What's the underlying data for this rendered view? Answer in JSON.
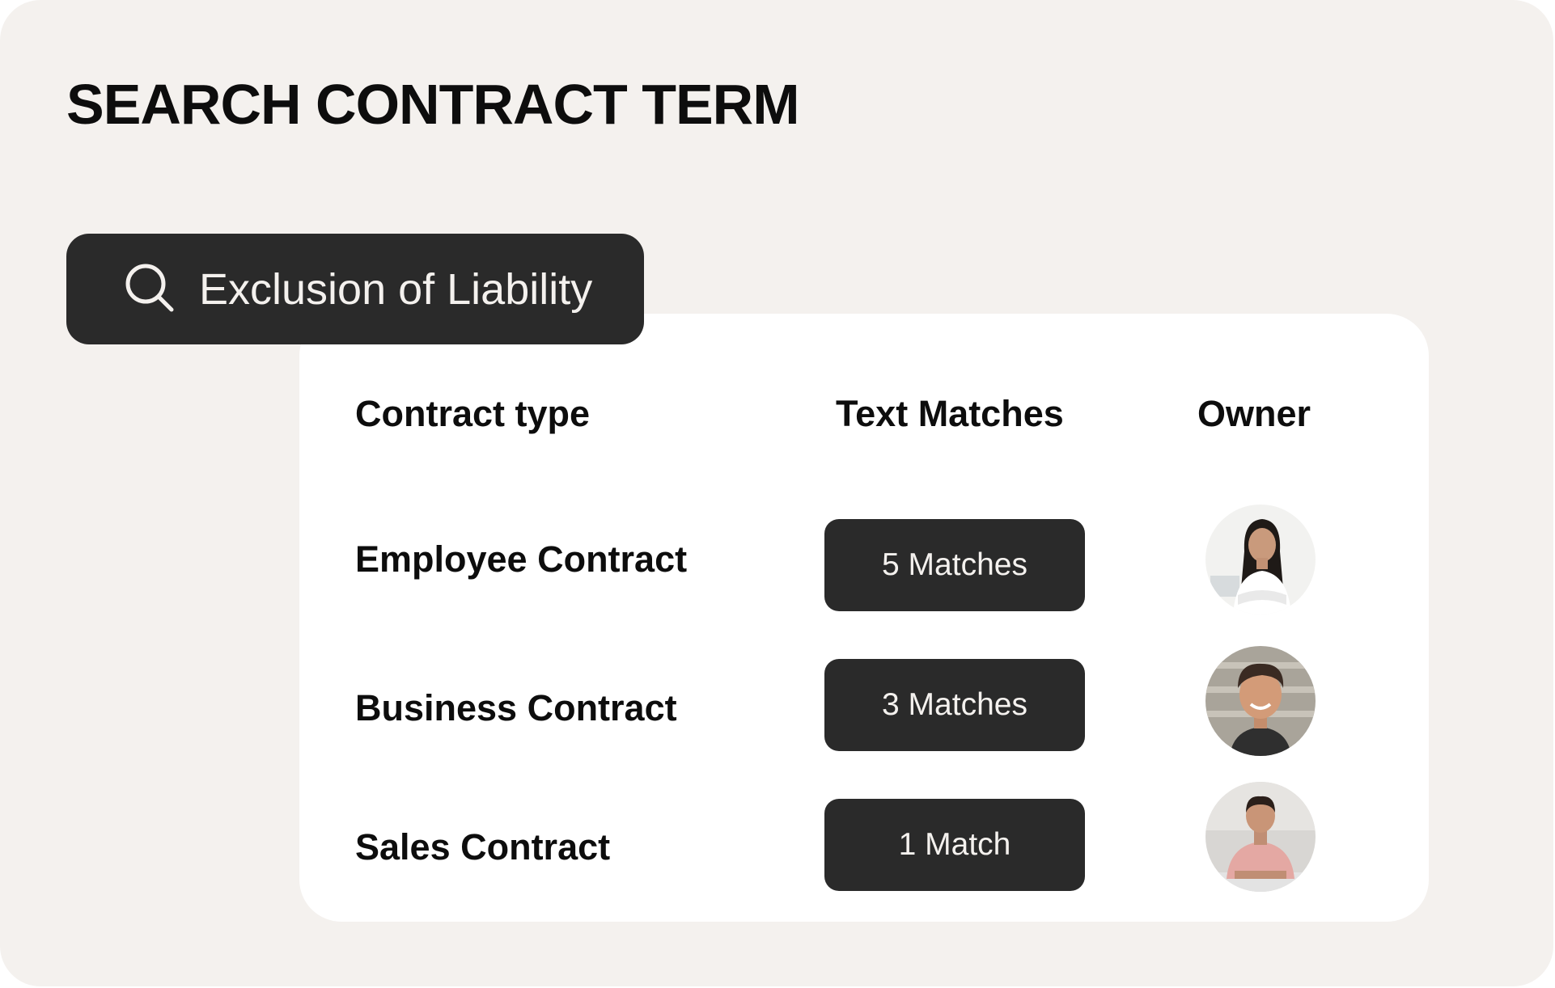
{
  "page": {
    "title": "SEARCH CONTRACT TERM"
  },
  "search": {
    "query": "Exclusion of Liability",
    "icon": "search-icon"
  },
  "table": {
    "headers": {
      "type": "Contract type",
      "matches": "Text Matches",
      "owner": "Owner"
    },
    "rows": [
      {
        "type": "Employee Contract",
        "matches": "5 Matches",
        "owner_avatar": "woman-avatar"
      },
      {
        "type": "Business Contract",
        "matches": "3 Matches",
        "owner_avatar": "man-avatar"
      },
      {
        "type": "Sales Contract",
        "matches": "1 Match",
        "owner_avatar": "man-avatar"
      }
    ]
  },
  "colors": {
    "background": "#f4f1ee",
    "card": "#ffffff",
    "dark": "#2a2a2a",
    "text": "#0d0d0d"
  }
}
